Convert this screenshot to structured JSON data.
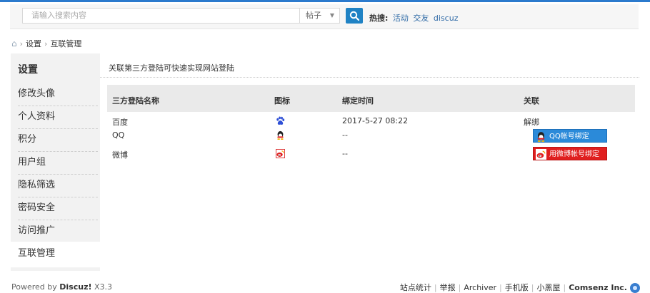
{
  "search": {
    "placeholder": "请输入搜索内容",
    "type_selected": "帖子",
    "hot_label": "热搜:",
    "hot_words": [
      "活动",
      "交友",
      "discuz"
    ]
  },
  "breadcrumb": {
    "items": [
      "设置",
      "互联管理"
    ]
  },
  "sidebar": {
    "title": "设置",
    "items": [
      "修改头像",
      "个人资料",
      "积分",
      "用户组",
      "隐私筛选",
      "密码安全",
      "访问推广",
      "互联管理"
    ],
    "active_index": 7
  },
  "main": {
    "intro": "关联第三方登陆可快速实现网站登陆",
    "columns": [
      "三方登陆名称",
      "图标",
      "绑定时间",
      "关联"
    ],
    "rows": [
      {
        "name": "百度",
        "icon": "baidu-paw-icon",
        "time": "2017-5-27 08:22",
        "action": "解绑"
      },
      {
        "name": "QQ",
        "icon": "qq-penguin-icon",
        "time": "--",
        "action": "QQ帐号绑定"
      },
      {
        "name": "微博",
        "icon": "weibo-icon",
        "time": "--",
        "action": "用微博帐号绑定"
      }
    ]
  },
  "footer": {
    "powered_prefix": "Powered by",
    "powered_brand": "Discuz!",
    "powered_version": "X3.3",
    "links": [
      "站点统计",
      "举报",
      "Archiver",
      "手机版",
      "小黑屋"
    ],
    "company": "Comsenz Inc."
  },
  "colors": {
    "accent": "#2b7acd",
    "qq_button": "#2b8ad9",
    "weibo_button": "#e01f1f"
  }
}
